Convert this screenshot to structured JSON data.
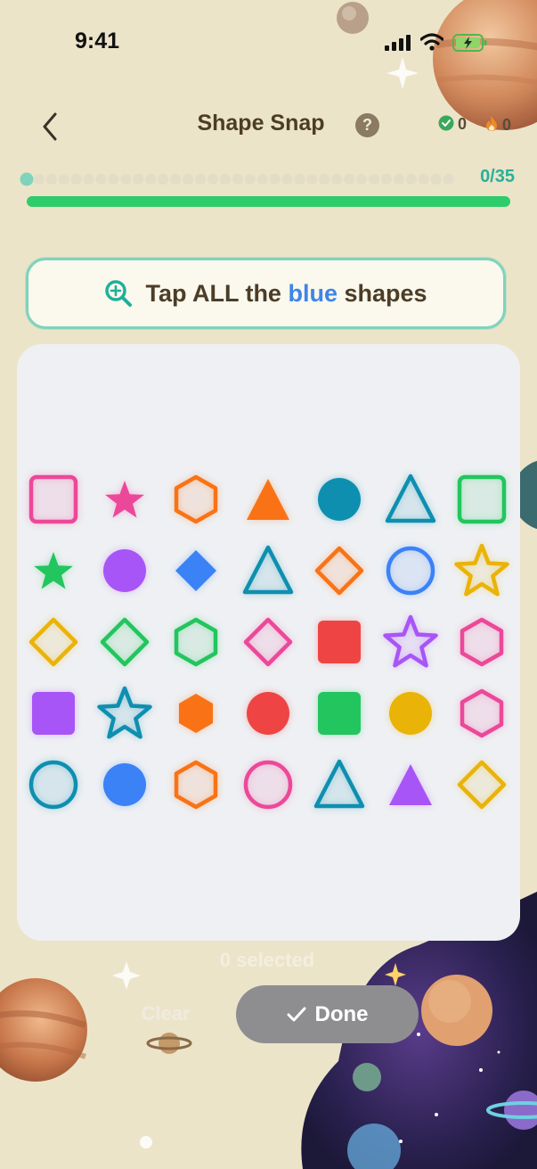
{
  "status_bar": {
    "time": "9:41"
  },
  "header": {
    "title": "Shape Snap",
    "help_label": "?",
    "correct_count": "0",
    "streak_count": "0"
  },
  "progress": {
    "counter": "0/35",
    "current": 0,
    "total": 35
  },
  "prompt": {
    "before": "Tap ALL the ",
    "color_word": "blue",
    "after": " shapes"
  },
  "board": {
    "shapes": [
      {
        "shape": "square",
        "color": "#ec4899",
        "style": "outline"
      },
      {
        "shape": "star",
        "color": "#ec4899",
        "style": "filled"
      },
      {
        "shape": "hexagon",
        "color": "#f97316",
        "style": "outline"
      },
      {
        "shape": "triangle",
        "color": "#f97316",
        "style": "filled"
      },
      {
        "shape": "circle",
        "color": "#0e8fb0",
        "style": "filled"
      },
      {
        "shape": "triangle",
        "color": "#0e8fb0",
        "style": "outline"
      },
      {
        "shape": "square",
        "color": "#22c55e",
        "style": "outline"
      },
      {
        "shape": "star",
        "color": "#22c55e",
        "style": "filled"
      },
      {
        "shape": "circle",
        "color": "#a855f7",
        "style": "filled"
      },
      {
        "shape": "diamond",
        "color": "#3b82f6",
        "style": "filled"
      },
      {
        "shape": "triangle",
        "color": "#0e8fb0",
        "style": "outline"
      },
      {
        "shape": "diamond",
        "color": "#f97316",
        "style": "outline"
      },
      {
        "shape": "circle",
        "color": "#3b82f6",
        "style": "outline"
      },
      {
        "shape": "star",
        "color": "#eab308",
        "style": "outline"
      },
      {
        "shape": "diamond",
        "color": "#eab308",
        "style": "outline"
      },
      {
        "shape": "diamond",
        "color": "#22c55e",
        "style": "outline"
      },
      {
        "shape": "hexagon",
        "color": "#22c55e",
        "style": "outline"
      },
      {
        "shape": "diamond",
        "color": "#ec4899",
        "style": "outline"
      },
      {
        "shape": "square",
        "color": "#ef4444",
        "style": "filled"
      },
      {
        "shape": "star",
        "color": "#a855f7",
        "style": "outline"
      },
      {
        "shape": "hexagon",
        "color": "#ec4899",
        "style": "outline"
      },
      {
        "shape": "square",
        "color": "#a855f7",
        "style": "filled"
      },
      {
        "shape": "star",
        "color": "#0e8fb0",
        "style": "outline"
      },
      {
        "shape": "hexagon",
        "color": "#f97316",
        "style": "filled"
      },
      {
        "shape": "circle",
        "color": "#ef4444",
        "style": "filled"
      },
      {
        "shape": "square",
        "color": "#22c55e",
        "style": "filled"
      },
      {
        "shape": "circle",
        "color": "#eab308",
        "style": "filled"
      },
      {
        "shape": "hexagon",
        "color": "#ec4899",
        "style": "outline"
      },
      {
        "shape": "circle",
        "color": "#0e8fb0",
        "style": "outline"
      },
      {
        "shape": "circle",
        "color": "#3b82f6",
        "style": "filled"
      },
      {
        "shape": "hexagon",
        "color": "#f97316",
        "style": "outline"
      },
      {
        "shape": "circle",
        "color": "#ec4899",
        "style": "outline"
      },
      {
        "shape": "triangle",
        "color": "#0e8fb0",
        "style": "outline"
      },
      {
        "shape": "triangle",
        "color": "#a855f7",
        "style": "filled"
      },
      {
        "shape": "diamond",
        "color": "#eab308",
        "style": "outline"
      }
    ]
  },
  "footer": {
    "selected_text": "0 selected",
    "clear_label": "Clear",
    "done_label": "Done"
  },
  "colors": {
    "accent_teal": "#27b19a",
    "progress_green": "#2ecc6a",
    "prompt_blue": "#3d86e8",
    "done_gray": "#8e8e91"
  }
}
